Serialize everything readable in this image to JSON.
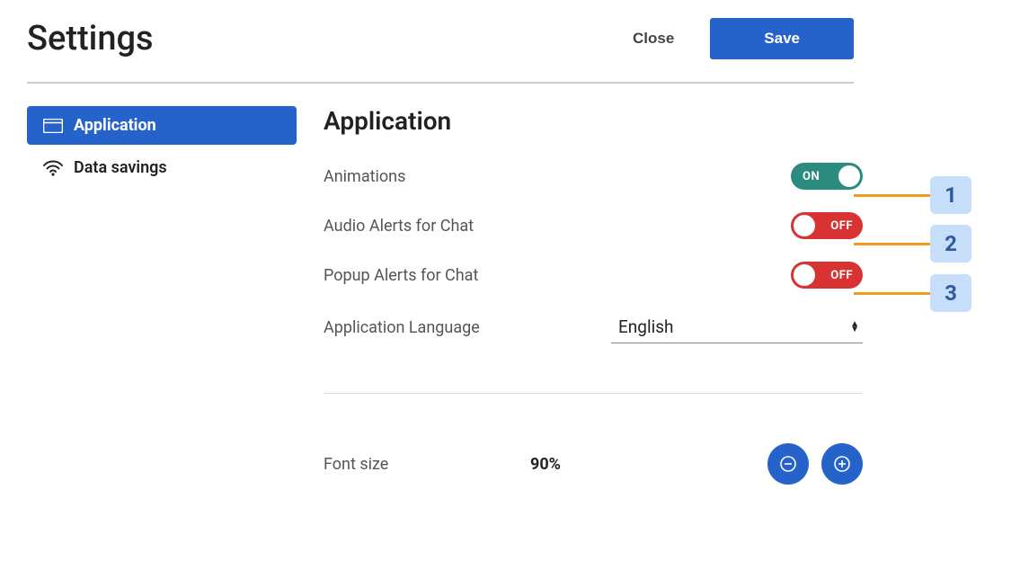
{
  "header": {
    "title": "Settings",
    "close_label": "Close",
    "save_label": "Save"
  },
  "sidebar": {
    "items": [
      {
        "label": "Application",
        "icon": "window-icon",
        "active": true
      },
      {
        "label": "Data savings",
        "icon": "wifi-icon",
        "active": false
      }
    ]
  },
  "main": {
    "heading": "Application",
    "toggles": [
      {
        "label": "Animations",
        "state": "ON",
        "on": true
      },
      {
        "label": "Audio Alerts for Chat",
        "state": "OFF",
        "on": false
      },
      {
        "label": "Popup Alerts for Chat",
        "state": "OFF",
        "on": false
      }
    ],
    "language": {
      "label": "Application Language",
      "value": "English"
    },
    "fontsize": {
      "label": "Font size",
      "value": "90%"
    }
  },
  "callouts": [
    "1",
    "2",
    "3"
  ]
}
